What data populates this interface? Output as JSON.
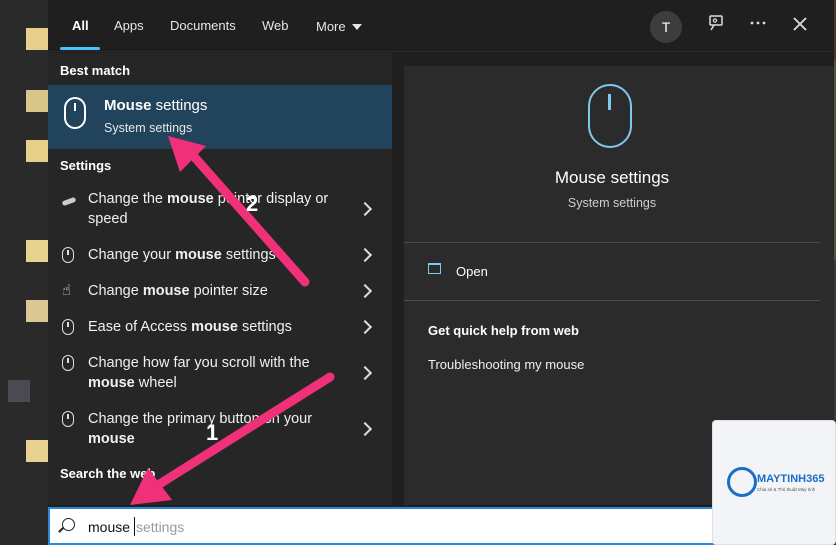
{
  "tabs": [
    {
      "label": "All"
    },
    {
      "label": "Apps"
    },
    {
      "label": "Documents"
    },
    {
      "label": "Web"
    },
    {
      "label": "More"
    }
  ],
  "avatar_initial": "T",
  "icons": {
    "feedback": "feedback-icon",
    "more_options": "ellipsis-icon",
    "close": "close-icon"
  },
  "best_match": {
    "heading": "Best match",
    "title_bold": "Mouse",
    "title_rest": " settings",
    "subtitle": "System settings"
  },
  "settings": {
    "heading": "Settings",
    "items": [
      {
        "pre": "Change the ",
        "bold": "mouse",
        "post": " pointer display or speed"
      },
      {
        "pre": "Change your ",
        "bold": "mouse",
        "post": " settings"
      },
      {
        "pre": "Change ",
        "bold": "mouse",
        "post": " pointer size"
      },
      {
        "pre": "Ease of Access ",
        "bold": "mouse",
        "post": " settings"
      },
      {
        "pre": "Change how far you scroll with the ",
        "bold": "mouse",
        "post": " wheel"
      },
      {
        "pre": "Change the primary button on your ",
        "bold": "mouse",
        "post": ""
      }
    ]
  },
  "search_web": {
    "heading": "Search the web"
  },
  "preview": {
    "title": "Mouse settings",
    "subtitle": "System settings",
    "open_label": "Open",
    "help_heading": "Get quick help from web",
    "help_link": "Troubleshooting my mouse"
  },
  "search": {
    "typed": "mouse",
    "ghost": "settings"
  },
  "annotations": {
    "arrow1_label": "1",
    "arrow2_label": "2",
    "color": "#f0317a"
  },
  "watermark": {
    "brand": "MAYTINH365",
    "tagline": "Chia sẻ & Thủ thuật Máy tính"
  },
  "colors": {
    "accent": "#4cc2ff",
    "selected_bg": "#21435b",
    "preview_icon": "#7fc8f0"
  }
}
